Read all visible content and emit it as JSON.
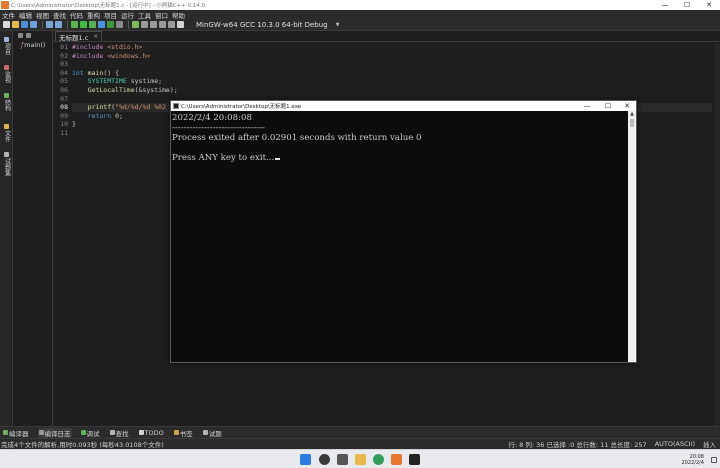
{
  "window": {
    "title": "C:\\Users\\Administrator\\Desktop\\无标题1.c - [运行中] - 小熊猫C++ 0.14.0",
    "controls": {
      "minimize": "—",
      "maximize": "☐",
      "close": "✕"
    }
  },
  "menu": {
    "items": [
      "文件",
      "编辑",
      "视图",
      "查找",
      "代码",
      "重构",
      "项目",
      "运行",
      "工具",
      "窗口",
      "帮助"
    ]
  },
  "toolbar": {
    "compiler": "MinGW-w64 GCC 10.3.0 64-bit Debug",
    "caret": "▼"
  },
  "sidebar": {
    "tabs": [
      "项目",
      "监视",
      "结构",
      "文件",
      "试题集"
    ]
  },
  "class_browser": {
    "items": [
      {
        "label": "main()",
        "icon": "function-icon"
      }
    ]
  },
  "editor": {
    "tab": {
      "label": "无标题1.c",
      "close": "×"
    },
    "line_numbers": [
      "01",
      "02",
      "03",
      "04",
      "05",
      "06",
      "07",
      "08",
      "09",
      "10",
      "11"
    ],
    "current_line": "08"
  },
  "console": {
    "title": "C:\\Users\\Administrator\\Desktop\\无标题1.exe",
    "lines": [
      "2022/2/4 20:08:08",
      "--------------------------------",
      "Process exited after 0.02901 seconds with return value 0",
      "",
      "Press ANY key to exit..."
    ],
    "controls": {
      "minimize": "—",
      "maximize": "☐",
      "close": "✕"
    }
  },
  "bottom_tabs": [
    "编译器",
    "编译日志",
    "调试",
    "查找",
    "TODO",
    "书签",
    "试题"
  ],
  "status": {
    "left": "完成4个文件的解析,用时0.093秒 (每秒43.0108个文件)",
    "position": "行: 8 列: 36 已选择 :0 总行数: 11 总长度: 257",
    "encoding": "AUTO(ASCII)",
    "mode": "插入"
  },
  "taskbar": {
    "time": "20:08",
    "date": "2022/2/4"
  },
  "colors": {
    "ide_background": "#1e1e1e",
    "console_background": "#0c0c0c",
    "keyword": "#569cd6",
    "string": "#ce9178",
    "type": "#4ec9b0"
  }
}
